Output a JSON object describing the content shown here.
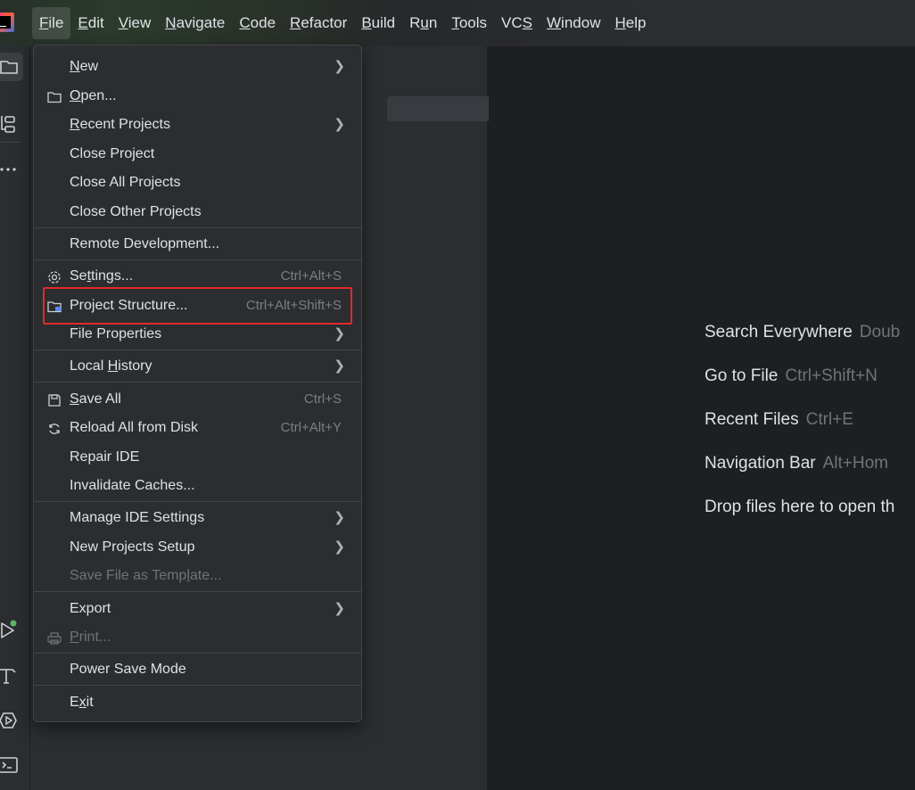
{
  "menubar": {
    "items": [
      {
        "pre": "",
        "u": "F",
        "post": "ile"
      },
      {
        "pre": "",
        "u": "E",
        "post": "dit"
      },
      {
        "pre": "",
        "u": "V",
        "post": "iew"
      },
      {
        "pre": "",
        "u": "N",
        "post": "avigate"
      },
      {
        "pre": "",
        "u": "C",
        "post": "ode"
      },
      {
        "pre": "",
        "u": "R",
        "post": "efactor"
      },
      {
        "pre": "",
        "u": "B",
        "post": "uild"
      },
      {
        "pre": "R",
        "u": "u",
        "post": "n"
      },
      {
        "pre": "",
        "u": "T",
        "post": "ools"
      },
      {
        "pre": "VC",
        "u": "S",
        "post": ""
      },
      {
        "pre": "",
        "u": "W",
        "post": "indow"
      },
      {
        "pre": "",
        "u": "H",
        "post": "elp"
      }
    ]
  },
  "file_menu": {
    "new": {
      "pre": "",
      "u": "N",
      "post": "ew"
    },
    "open": {
      "pre": "",
      "u": "O",
      "post": "pen..."
    },
    "recent_projects": {
      "pre": "",
      "u": "R",
      "post": "ecent Projects"
    },
    "close_project": "Close Project",
    "close_all_projects": "Close All Projects",
    "close_other_projects": "Close Other Projects",
    "remote_development": "Remote Development...",
    "settings": {
      "pre": "Se",
      "u": "t",
      "post": "tings...",
      "shortcut": "Ctrl+Alt+S"
    },
    "project_structure": {
      "label": "Project Structure...",
      "shortcut": "Ctrl+Alt+Shift+S"
    },
    "file_properties": "File Properties",
    "local_history": {
      "pre": "Local ",
      "u": "H",
      "post": "istory"
    },
    "save_all": {
      "pre": "",
      "u": "S",
      "post": "ave All",
      "shortcut": "Ctrl+S"
    },
    "reload_all": {
      "label": "Reload All from Disk",
      "shortcut": "Ctrl+Alt+Y"
    },
    "repair_ide": "Repair IDE",
    "invalidate_caches": "Invalidate Caches...",
    "manage_ide_settings": "Manage IDE Settings",
    "new_projects_setup": "New Projects Setup",
    "save_file_as_template": {
      "pre": "Save File as Temp",
      "u": "l",
      "post": "ate..."
    },
    "export": "Export",
    "print": {
      "pre": "",
      "u": "P",
      "post": "rint..."
    },
    "power_save_mode": "Power Save Mode",
    "exit": {
      "pre": "E",
      "u": "x",
      "post": "it"
    }
  },
  "editor_hints": [
    {
      "label": "Search Everywhere",
      "key": "Doub"
    },
    {
      "label": "Go to File",
      "key": "Ctrl+Shift+N"
    },
    {
      "label": "Recent Files",
      "key": "Ctrl+E"
    },
    {
      "label": "Navigation Bar",
      "key": "Alt+Hom"
    },
    {
      "label": "Drop files here to open th",
      "key": ""
    }
  ],
  "colors": {
    "accent_highlight": "#e0292e",
    "menu_bg": "#2b2d30",
    "editor_bg": "#1e1f22",
    "run_status_dot": "#5fb865"
  }
}
